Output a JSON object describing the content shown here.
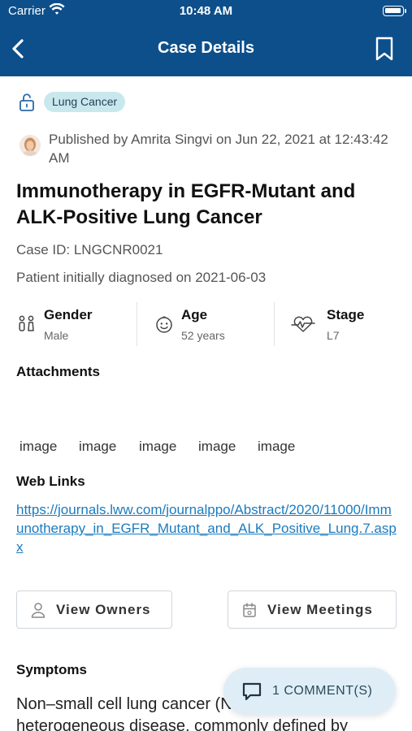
{
  "status_bar": {
    "carrier": "Carrier",
    "time": "10:48 AM",
    "battery_level": 1.0
  },
  "nav": {
    "title": "Case Details",
    "back_icon": "chevron-left-icon",
    "bookmark_icon": "bookmark-icon"
  },
  "tag": {
    "label": "Lung Cancer",
    "icon": "unlock-icon",
    "color": "#c9e8ee"
  },
  "publish": {
    "text": "Published by Amrita Singvi on Jun 22, 2021 at 12:43:42 AM"
  },
  "case": {
    "title": "Immunotherapy in EGFR-Mutant and ALK-Positive Lung Cancer",
    "id_line": "Case ID: LNGCNR0021",
    "diagnosed_line": "Patient initially diagnosed on 2021-06-03"
  },
  "stats": [
    {
      "label": "Gender",
      "value": "Male",
      "icon": "gender-icon"
    },
    {
      "label": "Age",
      "value": "52 years",
      "icon": "age-face-icon"
    },
    {
      "label": "Stage",
      "value": "L7",
      "icon": "heartbeat-icon"
    }
  ],
  "attachments": {
    "title": "Attachments",
    "items": [
      "image",
      "image",
      "image",
      "image",
      "image"
    ]
  },
  "web_links": {
    "title": "Web Links",
    "url": "https://journals.lww.com/journalppo/Abstract/2020/11000/Immunotherapy_in_EGFR_Mutant_and_ALK_Positive_Lung.7.aspx"
  },
  "buttons": {
    "view_owners": "View Owners",
    "view_meetings": "View Meetings"
  },
  "symptoms": {
    "title": "Symptoms",
    "text": "Non–small cell lung cancer (NSCLC) is a heterogeneous disease, commonly defined by"
  },
  "comments": {
    "label": "1 COMMENT(S)",
    "icon": "comment-icon"
  },
  "colors": {
    "header": "#0d4f8b",
    "link": "#1a7bbf",
    "fab": "#dfeef6"
  }
}
